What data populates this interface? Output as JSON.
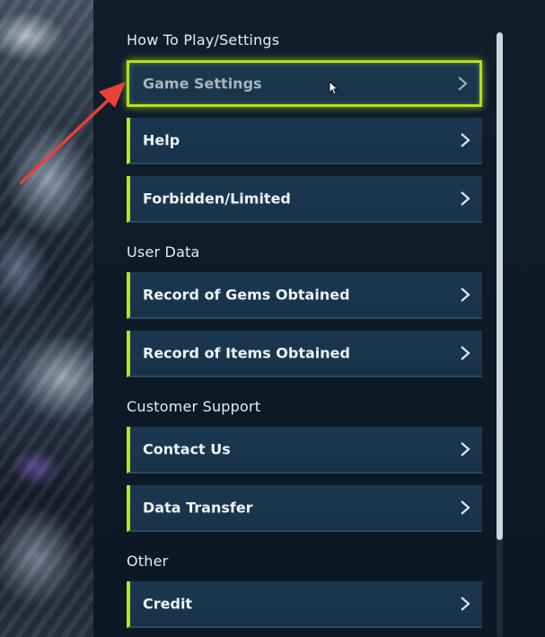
{
  "sections": [
    {
      "title": "How To Play/Settings",
      "items": [
        {
          "label": "Game Settings",
          "selected": true,
          "icon": "chevron-right-icon"
        },
        {
          "label": "Help",
          "icon": "chevron-right-icon"
        },
        {
          "label": "Forbidden/Limited",
          "icon": "chevron-right-icon"
        }
      ]
    },
    {
      "title": "User Data",
      "items": [
        {
          "label": "Record of Gems Obtained",
          "icon": "chevron-right-icon"
        },
        {
          "label": "Record of Items Obtained",
          "icon": "chevron-right-icon"
        }
      ]
    },
    {
      "title": "Customer Support",
      "items": [
        {
          "label": "Contact Us",
          "icon": "chevron-right-icon"
        },
        {
          "label": "Data Transfer",
          "icon": "chevron-right-icon"
        }
      ]
    },
    {
      "title": "Other",
      "items": [
        {
          "label": "Credit",
          "icon": "chevron-right-icon"
        }
      ]
    }
  ],
  "colors": {
    "accent": "#b7e51c",
    "item_bg": "#1b3750",
    "panel_bg": "#0d1a27",
    "annotation_arrow": "#e8403a"
  }
}
